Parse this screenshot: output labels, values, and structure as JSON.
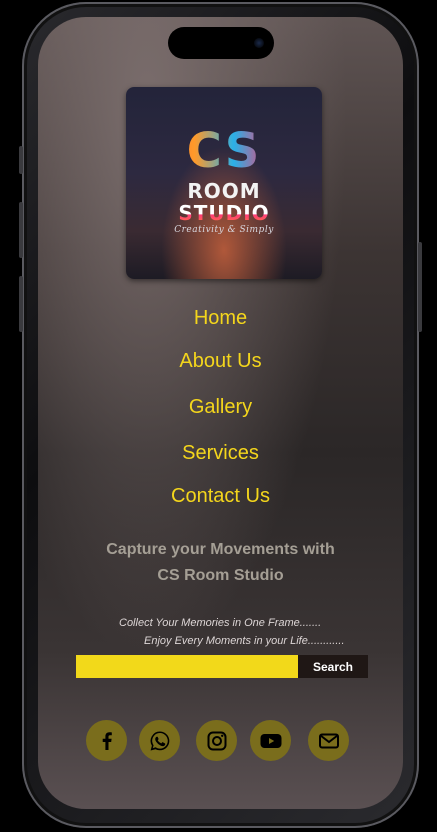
{
  "logo": {
    "line1": "CS",
    "line2": "ROOM",
    "line3": "STUDIO",
    "tagline": "Creativity & Simply"
  },
  "nav": {
    "items": [
      {
        "label": "Home"
      },
      {
        "label": "About Us"
      },
      {
        "label": "Gallery"
      },
      {
        "label": "Services"
      },
      {
        "label": "Contact Us"
      }
    ]
  },
  "hero": {
    "line1": "Capture your Movements with",
    "line2": "CS Room Studio"
  },
  "memo": {
    "line1": "Collect Your Memories in One Frame.......",
    "line2": "Enjoy Every Moments in your Life............"
  },
  "search": {
    "value": "",
    "placeholder": "",
    "button_label": "Search"
  },
  "social": {
    "icons": [
      "facebook-icon",
      "whatsapp-icon",
      "instagram-icon",
      "youtube-icon",
      "mail-icon"
    ]
  },
  "colors": {
    "accent": "#f4d61c",
    "social_bg": "#7a6d1c",
    "search_button_bg": "#1f1715"
  }
}
